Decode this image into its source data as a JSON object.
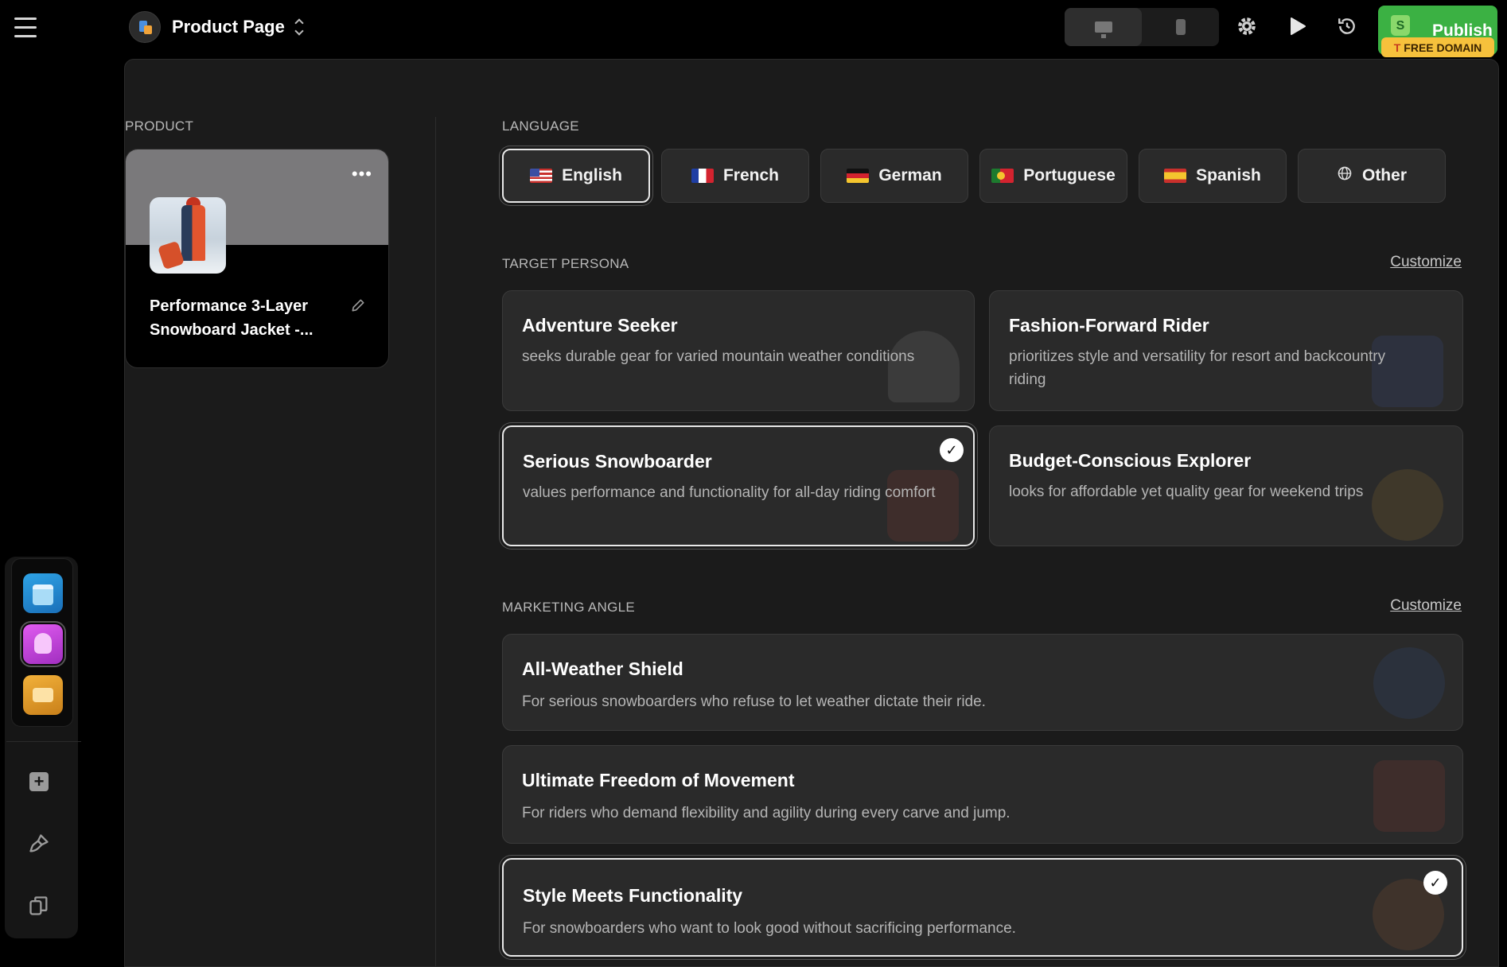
{
  "header": {
    "page_title": "Product Page",
    "publish_label": "Publish",
    "free_domain_label": "FREE DOMAIN",
    "icons": [
      "menu-icon",
      "desktop-icon",
      "mobile-icon",
      "gear-icon",
      "play-icon",
      "history-icon",
      "shopify-bag-icon"
    ]
  },
  "product": {
    "section_label": "PRODUCT",
    "name": "Performance 3-Layer Snowboard Jacket -..."
  },
  "language": {
    "section_label": "LANGUAGE",
    "options": [
      {
        "label": "English",
        "flag": "us-flag-icon",
        "selected": true
      },
      {
        "label": "French",
        "flag": "fr-flag-icon",
        "selected": false
      },
      {
        "label": "German",
        "flag": "de-flag-icon",
        "selected": false
      },
      {
        "label": "Portuguese",
        "flag": "pt-flag-icon",
        "selected": false
      },
      {
        "label": "Spanish",
        "flag": "es-flag-icon",
        "selected": false
      },
      {
        "label": "Other",
        "flag": "globe-icon",
        "selected": false
      }
    ]
  },
  "persona": {
    "section_label": "TARGET PERSONA",
    "customize_label": "Customize",
    "items": [
      {
        "title": "Adventure Seeker",
        "desc": "seeks durable gear for varied mountain weather conditions",
        "selected": false
      },
      {
        "title": "Fashion-Forward Rider",
        "desc": "prioritizes style and versatility for resort and backcountry riding",
        "selected": false
      },
      {
        "title": "Serious Snowboarder",
        "desc": "values performance and functionality for all-day riding comfort",
        "selected": true
      },
      {
        "title": "Budget-Conscious Explorer",
        "desc": "looks for affordable yet quality gear for weekend trips",
        "selected": false
      }
    ]
  },
  "marketing": {
    "section_label": "MARKETING ANGLE",
    "customize_label": "Customize",
    "items": [
      {
        "title": "All-Weather Shield",
        "desc": "For serious snowboarders who refuse to let weather dictate their ride.",
        "selected": false
      },
      {
        "title": "Ultimate Freedom of Movement",
        "desc": "For riders who demand flexibility and agility during every carve and jump.",
        "selected": false
      },
      {
        "title": "Style Meets Functionality",
        "desc": "For snowboarders who want to look good without sacrificing performance.",
        "selected": true
      }
    ]
  },
  "colors": {
    "publish_green": "#3bb143",
    "free_domain_yellow": "#f6c13c",
    "panel_bg": "#1b1b1b",
    "card_bg": "#2a2a2a"
  }
}
